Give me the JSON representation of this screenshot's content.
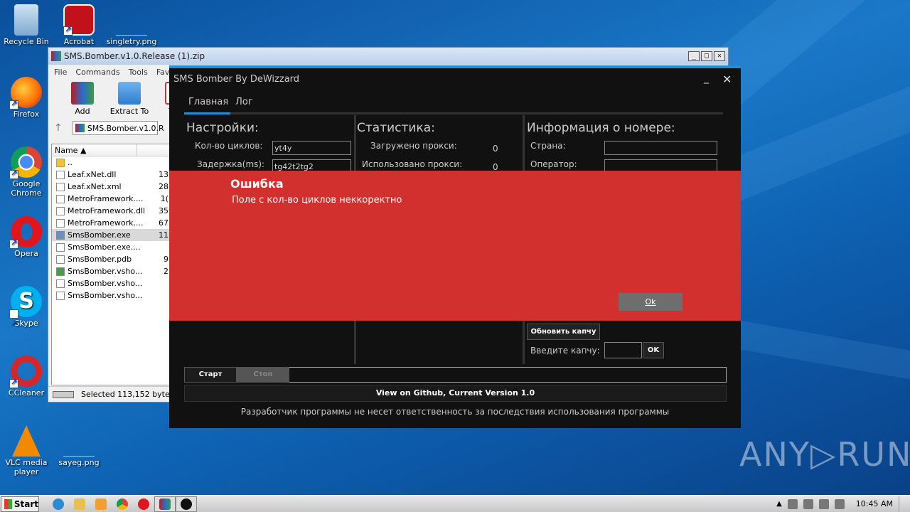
{
  "desktop": {
    "icons": [
      {
        "label": "Recycle Bin"
      },
      {
        "label": "Acrobat"
      },
      {
        "label": "singletry.png"
      },
      {
        "label": "Firefox"
      },
      {
        "label": "Google Chrome"
      },
      {
        "label": "Opera"
      },
      {
        "label": "Skype"
      },
      {
        "label": "CCleaner"
      },
      {
        "label": "VLC media player"
      },
      {
        "label": "sayeg.png"
      }
    ],
    "watermark": "ANY▷RUN"
  },
  "winrar": {
    "title": "SMS.Bomber.v1.0.Release (1).zip",
    "window_buttons": [
      "_",
      "□",
      "✕"
    ],
    "menu": [
      "File",
      "Commands",
      "Tools",
      "Favorit"
    ],
    "tools": [
      {
        "label": "Add",
        "icon": "archive-add-icon"
      },
      {
        "label": "Extract To",
        "icon": "folder-extract-icon"
      },
      {
        "label": "Test",
        "icon": "test-icon"
      }
    ],
    "up_arrow": "↑",
    "path": "SMS.Bomber.v1.0.R",
    "column_name": "Name ▲",
    "files": [
      {
        "name": "..",
        "size": ""
      },
      {
        "name": "Leaf.xNet.dll",
        "size": "13"
      },
      {
        "name": "Leaf.xNet.xml",
        "size": "28"
      },
      {
        "name": "MetroFramework....",
        "size": "1("
      },
      {
        "name": "MetroFramework.dll",
        "size": "35"
      },
      {
        "name": "MetroFramework....",
        "size": "67"
      },
      {
        "name": "SmsBomber.exe",
        "size": "11"
      },
      {
        "name": "SmsBomber.exe....",
        "size": ""
      },
      {
        "name": "SmsBomber.pdb",
        "size": "9"
      },
      {
        "name": "SmsBomber.vsho...",
        "size": "2"
      },
      {
        "name": "SmsBomber.vsho...",
        "size": ""
      },
      {
        "name": "SmsBomber.vsho...",
        "size": ""
      }
    ],
    "status": "Selected 113,152 bytes in"
  },
  "bomber": {
    "title": "SMS Bomber By DeWizzard",
    "minimize": "_",
    "close": "✕",
    "tabs": [
      "Главная",
      "Лог"
    ],
    "settings": {
      "heading": "Настройки:",
      "cycles_label": "Кол-во циклов:",
      "cycles_value": "yt4y",
      "delay_label": "Задержка(ms):",
      "delay_value": "tg42t2tg2"
    },
    "stats": {
      "heading": "Статистика:",
      "loaded_label": "Загружено прокси:",
      "loaded_value": "0",
      "used_label": "Использовано прокси:",
      "used_value": "0"
    },
    "number_info": {
      "heading": "Информация о номере:",
      "country_label": "Страна:",
      "country_value": "",
      "operator_label": "Оператор:",
      "operator_value": ""
    },
    "captcha": {
      "refresh_label": "Обновить капчу",
      "enter_label": "Введите капчу:",
      "value": "",
      "ok_label": "OK"
    },
    "start_label": "Старт",
    "stop_label": "Стоп",
    "github_label": "View on Github, Current Version 1.0",
    "disclaimer": "Разработчик программы не несет ответственность за последствия использования программы"
  },
  "error_dialog": {
    "title": "Ошибка",
    "message": "Поле с кол-во циклов неккоректно",
    "ok_label": "Ok",
    "color": "#d2302e"
  },
  "taskbar": {
    "start_label": "Start",
    "clock": "10:45 AM"
  }
}
